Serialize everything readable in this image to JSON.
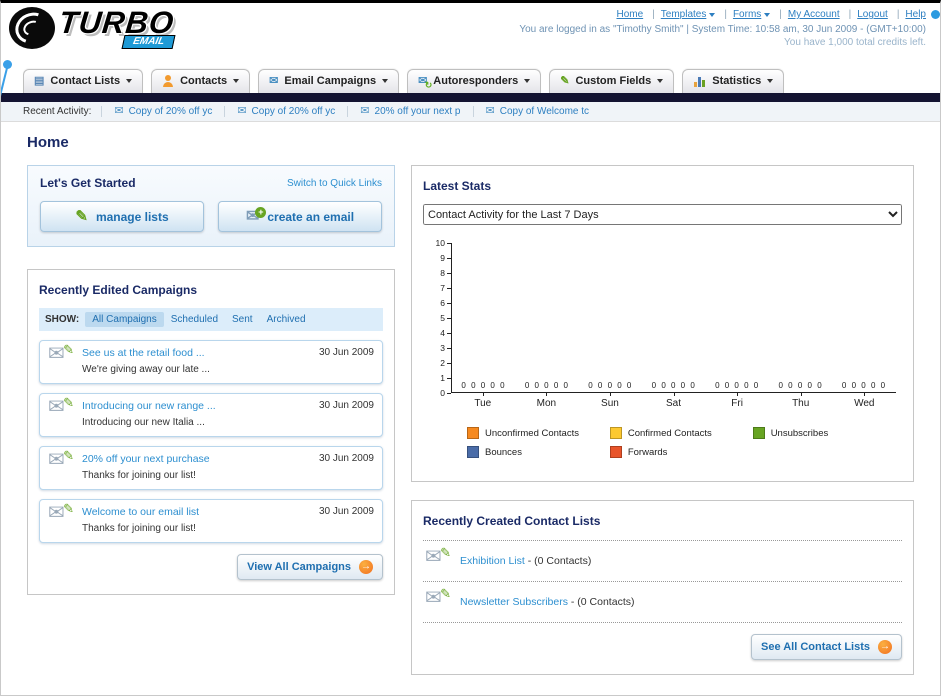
{
  "header": {
    "logo_line1": "TURBO",
    "logo_line2": "EMAIL",
    "links": [
      {
        "label": "Home",
        "dropdown": false
      },
      {
        "label": "Templates",
        "dropdown": true
      },
      {
        "label": "Forms",
        "dropdown": true
      },
      {
        "label": "My Account",
        "dropdown": false
      },
      {
        "label": "Logout",
        "dropdown": false
      },
      {
        "label": "Help",
        "dropdown": false
      }
    ],
    "login_info": "You are logged in as \"Timothy Smith\" | System Time: 10:58 am, 30 Jun 2009 - (GMT+10:00)",
    "credits_info": "You have 1,000 total credits left."
  },
  "nav": {
    "tabs": [
      {
        "label": "Contact Lists",
        "icon": "contact-lists-icon"
      },
      {
        "label": "Contacts",
        "icon": "contacts-icon"
      },
      {
        "label": "Email Campaigns",
        "icon": "email-campaigns-icon"
      },
      {
        "label": "Autoresponders",
        "icon": "autoresponders-icon"
      },
      {
        "label": "Custom Fields",
        "icon": "custom-fields-icon"
      },
      {
        "label": "Statistics",
        "icon": "statistics-icon"
      }
    ]
  },
  "recent_activity": {
    "label": "Recent Activity:",
    "items": [
      "Copy of 20% off yc",
      "Copy of 20% off yc",
      "20% off your next p",
      "Copy of Welcome tc"
    ]
  },
  "page": {
    "title": "Home"
  },
  "get_started": {
    "title": "Let's Get Started",
    "switch_link": "Switch to Quick Links",
    "manage_lists_button": "manage lists",
    "create_email_button": "create an email"
  },
  "campaigns": {
    "title": "Recently Edited Campaigns",
    "show_label": "SHOW:",
    "filters": [
      "All Campaigns",
      "Scheduled",
      "Sent",
      "Archived"
    ],
    "items": [
      {
        "title": "See us at the retail food ...",
        "subtitle": "We're giving away our late ...",
        "date": "30 Jun 2009"
      },
      {
        "title": "Introducing our new range ...",
        "subtitle": "Introducing our new Italia ...",
        "date": "30 Jun 2009"
      },
      {
        "title": "20% off your next purchase",
        "subtitle": "Thanks for joining our list!",
        "date": "30 Jun 2009"
      },
      {
        "title": "Welcome to our email list",
        "subtitle": "Thanks for joining our list!",
        "date": "30 Jun 2009"
      }
    ],
    "view_all_button": "View All Campaigns"
  },
  "stats": {
    "title": "Latest Stats",
    "selected_option": "Contact Activity for the Last 7 Days",
    "chart_data": {
      "type": "bar",
      "title": "Contact Activity for the Last 7 Days",
      "categories": [
        "Tue",
        "Mon",
        "Sun",
        "Sat",
        "Fri",
        "Thu",
        "Wed"
      ],
      "series": [
        {
          "name": "Unconfirmed Contacts",
          "color": "#f6891f",
          "values": [
            0,
            0,
            0,
            0,
            0,
            0,
            0
          ]
        },
        {
          "name": "Confirmed Contacts",
          "color": "#fdc930",
          "values": [
            0,
            0,
            0,
            0,
            0,
            0,
            0
          ]
        },
        {
          "name": "Unsubscribes",
          "color": "#67a422",
          "values": [
            0,
            0,
            0,
            0,
            0,
            0,
            0
          ]
        },
        {
          "name": "Bounces",
          "color": "#4a6ca8",
          "values": [
            0,
            0,
            0,
            0,
            0,
            0,
            0
          ]
        },
        {
          "name": "Forwards",
          "color": "#e8542a",
          "values": [
            0,
            0,
            0,
            0,
            0,
            0,
            0
          ]
        }
      ],
      "ylim": [
        0,
        10
      ],
      "y_tick_step": 1,
      "grid": false,
      "legend_position": "bottom"
    }
  },
  "contact_lists": {
    "title": "Recently Created Contact Lists",
    "items": [
      {
        "name": "Exhibition List",
        "separator": " - ",
        "count": "(0 Contacts)"
      },
      {
        "name": "Newsletter Subscribers",
        "separator": " - ",
        "count": "(0 Contacts)"
      }
    ],
    "see_all_button": "See All Contact Lists"
  }
}
